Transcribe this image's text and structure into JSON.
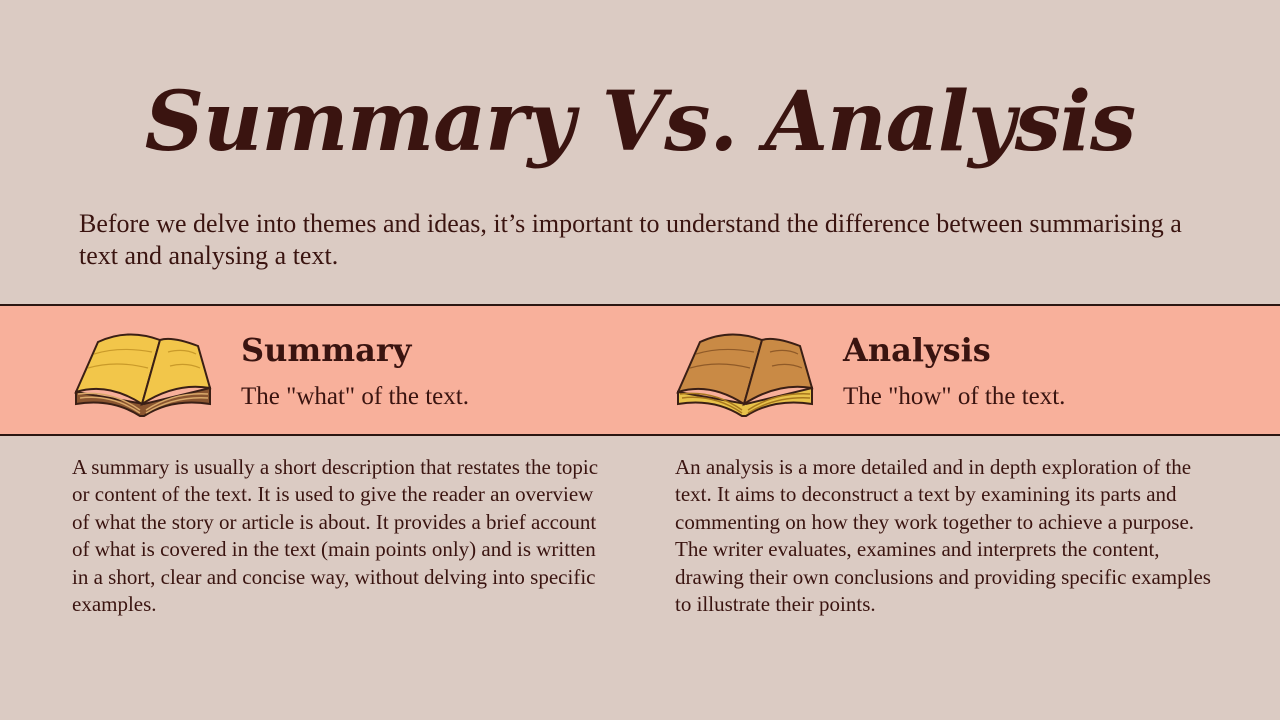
{
  "title": "Summary Vs.  Analysis",
  "intro": "Before we delve into themes and ideas, it’s important to understand the difference between summarising a text and analysing a text.",
  "colors": {
    "background": "#dbcbc3",
    "band": "#f8b09b",
    "text": "#3a1410",
    "summary_book": "#f2c64a",
    "analysis_book": "#c98a45"
  },
  "summary": {
    "icon": "open-book-icon",
    "heading": "Summary",
    "subheading": "The \"what\" of the text.",
    "description": "A summary is usually a short description that restates the topic or content of the text. It is used to give the reader an overview of what the story or article is about. It provides a brief account of what is covered in the text (main points only) and is written in a short, clear and concise way, without delving into specific examples."
  },
  "analysis": {
    "icon": "open-book-icon",
    "heading": "Analysis",
    "subheading": "The \"how\" of the text.",
    "description": "An analysis is a more detailed and in depth exploration of the text. It aims to deconstruct a text by examining its parts and commenting on how they work together to achieve a purpose. The writer evaluates, examines and interprets the content, drawing their own conclusions and providing specific examples to illustrate their points."
  }
}
